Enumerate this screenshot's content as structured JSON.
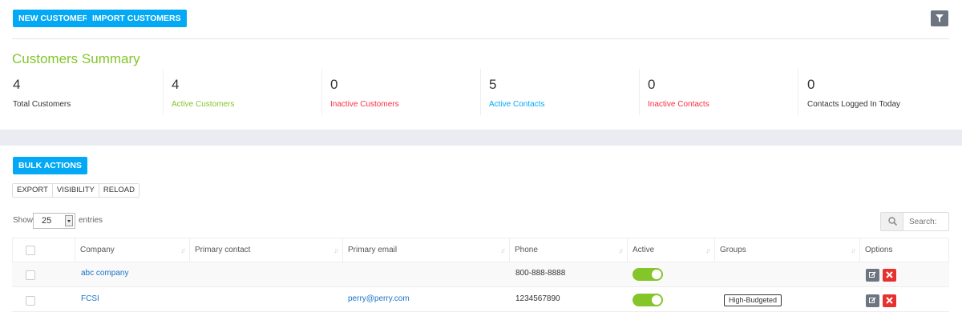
{
  "toolbar": {
    "new_customer": "NEW CUSTOMER",
    "import_customers": "IMPORT CUSTOMERS",
    "filter_icon": "filter-icon"
  },
  "summary": {
    "title": "Customers Summary",
    "stats": [
      {
        "value": "4",
        "label": "Total Customers",
        "color": "#333333"
      },
      {
        "value": "4",
        "label": "Active Customers",
        "color": "#84c529"
      },
      {
        "value": "0",
        "label": "Inactive Customers",
        "color": "#fc2d42"
      },
      {
        "value": "5",
        "label": "Active Contacts",
        "color": "#03a9f4"
      },
      {
        "value": "0",
        "label": "Inactive Contacts",
        "color": "#fc2d42"
      },
      {
        "value": "0",
        "label": "Contacts Logged In Today",
        "color": "#333333"
      }
    ]
  },
  "table_controls": {
    "bulk_actions": "BULK ACTIONS",
    "export": "EXPORT",
    "visibility": "VISIBILITY",
    "reload": "RELOAD",
    "show": "Show",
    "page_length": "25",
    "entries": "entries",
    "search_placeholder": "Search:"
  },
  "table": {
    "columns": [
      "Company",
      "Primary contact",
      "Primary email",
      "Phone",
      "Active",
      "Groups",
      "Options"
    ],
    "rows": [
      {
        "company": "abc company",
        "primary_contact": "",
        "primary_email": "",
        "phone": "800-888-8888",
        "active": true,
        "groups": ""
      },
      {
        "company": "FCSI",
        "primary_contact": "",
        "primary_email": "perry@perry.com",
        "phone": "1234567890",
        "active": true,
        "groups": "High-Budgeted"
      }
    ]
  },
  "colors": {
    "accent_blue": "#03a9f4",
    "accent_green": "#84c529",
    "danger_red": "#e7312f",
    "filter_gray": "#6d7580"
  }
}
